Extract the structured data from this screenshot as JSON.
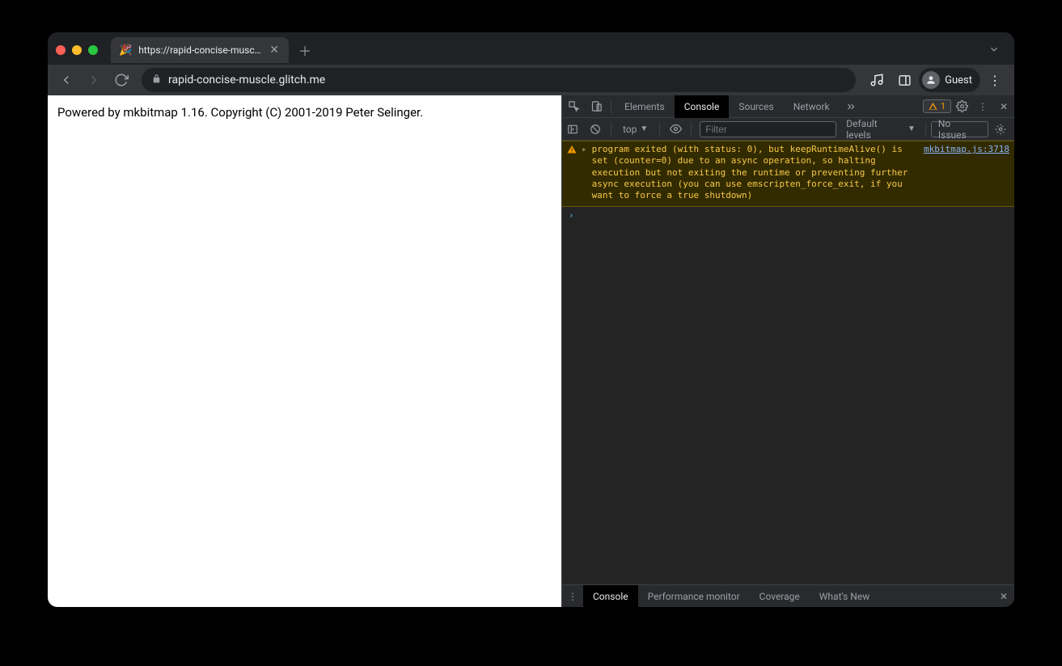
{
  "tab": {
    "title": "https://rapid-concise-muscle.g",
    "favicon": "🎉"
  },
  "address": {
    "url": "rapid-concise-muscle.glitch.me"
  },
  "toolbar": {
    "guest_label": "Guest"
  },
  "page": {
    "content": "Powered by mkbitmap 1.16. Copyright (C) 2001-2019 Peter Selinger."
  },
  "devtools": {
    "tabs": {
      "elements": "Elements",
      "console": "Console",
      "sources": "Sources",
      "network": "Network"
    },
    "warn_count": "1",
    "console_toolbar": {
      "context": "top",
      "filter_placeholder": "Filter",
      "default_levels": "Default levels",
      "no_issues": "No Issues"
    },
    "console_msg": {
      "text": "program exited (with status: 0), but keepRuntimeAlive() is set (counter=0) due to an async operation, so halting execution but not exiting the runtime or preventing further async execution (you can use emscripten_force_exit, if you want to force a true shutdown)",
      "source": "mkbitmap.js:3718"
    },
    "drawer": {
      "console": "Console",
      "perf": "Performance monitor",
      "coverage": "Coverage",
      "whatsnew": "What's New"
    }
  }
}
